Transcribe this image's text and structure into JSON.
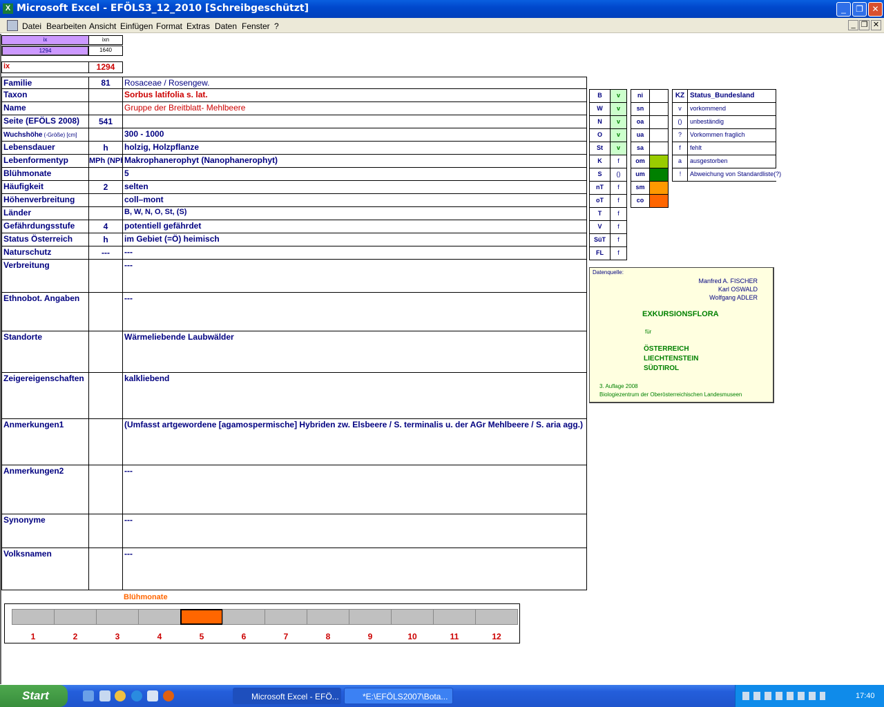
{
  "window": {
    "title": "Microsoft Excel - EFÖLS3_12_2010  [Schreibgeschützt]",
    "app_icon": "excel-icon"
  },
  "menu": [
    "Datei",
    "Bearbeiten",
    "Ansicht",
    "Einfügen",
    "Format",
    "Extras",
    "Daten",
    "Fenster",
    "?"
  ],
  "index_box": {
    "h1": "ix",
    "h2": "ixn",
    "v1": "1294",
    "v2": "1640",
    "ix_label": "ix",
    "ix_value": "1294"
  },
  "rows": [
    {
      "label": "Familie",
      "num": "81",
      "value": "Rosaceae  /  Rosengew."
    },
    {
      "label": "Taxon",
      "num": "",
      "value": "Sorbus latifolia s. lat."
    },
    {
      "label": "Name",
      "num": "",
      "value": "Gruppe der Breitblatt- Mehlbeere"
    },
    {
      "label": "Seite (EFÖLS 2008)",
      "num": "541",
      "value": ""
    },
    {
      "label": "Wuchshöhe",
      "label_small": "(-Größe) [cm]",
      "num": "",
      "value": "300 - 1000"
    },
    {
      "label": "Lebensdauer",
      "num": "h",
      "value": "holzig, Holzpflanze"
    },
    {
      "label": "Lebenformentyp",
      "num": "MPh (NPh",
      "value": "Makrophanerophyt (Nanophanerophyt)"
    },
    {
      "label": "Blühmonate",
      "num": "",
      "value": "5"
    },
    {
      "label": "Häufigkeit",
      "num": "2",
      "value": "selten"
    },
    {
      "label": "Höhenverbreitung",
      "num": "",
      "value": "coll–mont"
    },
    {
      "label": "Länder",
      "num": "",
      "value": "B, W, N, O, St, (S)"
    },
    {
      "label": "Gefährdungsstufe",
      "num": "4",
      "value": "potentiell gefährdet"
    },
    {
      "label": "Status Österreich",
      "num": "h",
      "value": "im Gebiet (=Ö) heimisch"
    },
    {
      "label": "Naturschutz",
      "num": "---",
      "value": "---"
    },
    {
      "label": "Verbreitung",
      "num": "",
      "value": "---"
    },
    {
      "label": "Ethnobot. Angaben",
      "num": "",
      "value": "---"
    },
    {
      "label": "Standorte",
      "num": "",
      "value": "Wärmeliebende Laubwälder"
    },
    {
      "label": "Zeigereigenschaften",
      "num": "",
      "value": "kalkliebend"
    },
    {
      "label": "Anmerkungen1",
      "num": "",
      "value": "(Umfasst artgewordene [agamospermische] Hybriden zw. Elsbeere / S. terminalis u. der AGr Mehlbeere / S. aria agg.)"
    },
    {
      "label": "Anmerkungen2",
      "num": "",
      "value": "---"
    },
    {
      "label": "Synonyme",
      "num": "",
      "value": "---"
    },
    {
      "label": "Volksnamen",
      "num": "",
      "value": "---"
    }
  ],
  "states": [
    {
      "k": "B",
      "v": "v"
    },
    {
      "k": "W",
      "v": "v"
    },
    {
      "k": "N",
      "v": "v"
    },
    {
      "k": "O",
      "v": "v"
    },
    {
      "k": "St",
      "v": "v"
    },
    {
      "k": "K",
      "v": "f"
    },
    {
      "k": "S",
      "v": "()"
    },
    {
      "k": "nT",
      "v": "f"
    },
    {
      "k": "oT",
      "v": "f"
    },
    {
      "k": "T",
      "v": "f"
    },
    {
      "k": "V",
      "v": "f"
    },
    {
      "k": "SüT",
      "v": "f"
    },
    {
      "k": "FL",
      "v": "f"
    }
  ],
  "regions": [
    {
      "k": "ni",
      "color": ""
    },
    {
      "k": "sn",
      "color": ""
    },
    {
      "k": "oa",
      "color": ""
    },
    {
      "k": "ua",
      "color": ""
    },
    {
      "k": "sa",
      "color": ""
    },
    {
      "k": "om",
      "color": "#99cc00"
    },
    {
      "k": "um",
      "color": "#008000"
    },
    {
      "k": "sm",
      "color": "#ff9900"
    },
    {
      "k": "co",
      "color": "#ff6600"
    }
  ],
  "status_legend": {
    "head_k": "KZ",
    "head_v": "Status_Bundesland",
    "items": [
      {
        "k": "v",
        "v": "vorkommend"
      },
      {
        "k": "()",
        "v": "unbeständig"
      },
      {
        "k": "?",
        "v": "Vorkommen fraglich"
      },
      {
        "k": "f",
        "v": "fehlt"
      },
      {
        "k": "a",
        "v": "ausgestorben"
      },
      {
        "k": "!",
        "v": "Abweichung von Standardliste(?)"
      }
    ]
  },
  "source": {
    "label": "Datenquelle:",
    "authors": [
      "Manfred A. FISCHER",
      "Karl OSWALD",
      "Wolfgang ADLER"
    ],
    "title": "EXKURSIONSFLORA",
    "fuer": "für",
    "countries": [
      "ÖSTERREICH",
      "LIECHTENSTEIN",
      "SÜDTIROL"
    ],
    "edition": "3. Auflage 2008",
    "publisher": "Biologiezentrum der Oberösterreichischen Landesmuseen"
  },
  "bloom": {
    "title": "Blühmonate",
    "months": [
      "1",
      "2",
      "3",
      "4",
      "5",
      "6",
      "7",
      "8",
      "9",
      "10",
      "11",
      "12"
    ],
    "active": [
      5
    ],
    "active_color": "#ff6600"
  },
  "taskbar": {
    "start": "Start",
    "tasks": [
      "Microsoft Excel - EFÖ...",
      "*E:\\EFÖLS2007\\Bota..."
    ],
    "clock": "17:40"
  }
}
